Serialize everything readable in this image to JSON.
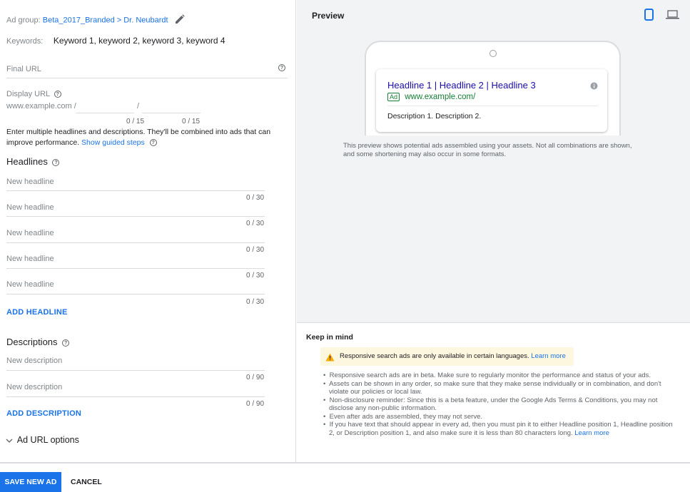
{
  "ad_group": {
    "label": "Ad group:",
    "value": "Beta_2017_Branded > Dr. Neubardt"
  },
  "keywords": {
    "label": "Keywords:",
    "value": "Keyword 1, keyword 2, keyword 3, keyword 4"
  },
  "final_url": {
    "placeholder": "Final URL"
  },
  "display_url": {
    "label": "Display URL",
    "base": "www.example.com /",
    "sep": "/",
    "path1_counter": "0 / 15",
    "path2_counter": "0 / 15"
  },
  "intro": {
    "line1": "Enter multiple headlines and descriptions. They'll be combined into ads that can",
    "line2": "improve performance.",
    "guided_link": "Show guided steps"
  },
  "headlines": {
    "title": "Headlines",
    "items": [
      {
        "placeholder": "New headline",
        "counter": "0 / 30"
      },
      {
        "placeholder": "New headline",
        "counter": "0 / 30"
      },
      {
        "placeholder": "New headline",
        "counter": "0 / 30"
      },
      {
        "placeholder": "New headline",
        "counter": "0 / 30"
      },
      {
        "placeholder": "New headline",
        "counter": "0 / 30"
      }
    ],
    "add_label": "ADD HEADLINE"
  },
  "descriptions": {
    "title": "Descriptions",
    "items": [
      {
        "placeholder": "New description",
        "counter": "0 / 90"
      },
      {
        "placeholder": "New description",
        "counter": "0 / 90"
      }
    ],
    "add_label": "ADD DESCRIPTION"
  },
  "ad_url_options": {
    "label": "Ad URL options"
  },
  "preview": {
    "title": "Preview",
    "ad": {
      "headline": "Headline 1 | Headline 2 | Headline 3",
      "badge": "Ad",
      "url": "www.example.com/",
      "description": "Description 1. Description 2."
    },
    "caption_line1": "This preview shows potential ads assembled using your assets. Not all combinations are shown,",
    "caption_line2": "and some shortening may also occur in some formats."
  },
  "keep_in_mind": {
    "title": "Keep in mind",
    "warning": "Responsive search ads are only available in certain languages.",
    "warning_link": "Learn more",
    "bullets": [
      "Responsive search ads are in beta. Make sure to regularly monitor the performance and status of your ads.",
      "Assets can be shown in any order, so make sure that they make sense individually or in combination, and don't",
      "violate our policies or local law.",
      "Non-disclosure reminder: Since this is a beta feature, under the Google Ads Terms & Conditions, you may not",
      "disclose any non-public information.",
      "Even after ads are assembled, they may not serve.",
      "If you have text that should appear in every ad, then you must pin it to either Headline position 1, Headline position",
      "2, or Description position 1, and also make sure it is less than 80 characters long."
    ],
    "last_link": "Learn more"
  },
  "footer": {
    "save_label": "SAVE NEW AD",
    "cancel_label": "CANCEL"
  },
  "colors": {
    "accent": "#1a73e8",
    "save_bg": "#1a73e8",
    "ad_url": "#188038",
    "headline": "#1a0dab",
    "warn_bg": "#fef7e0",
    "warn_icon": "#f9ab00"
  }
}
